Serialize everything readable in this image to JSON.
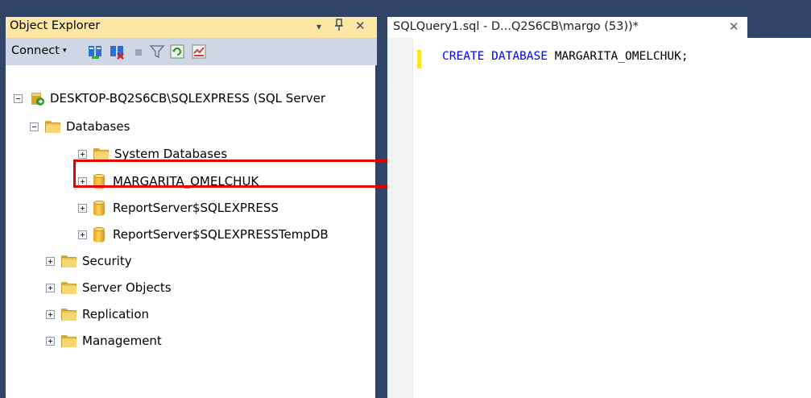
{
  "object_explorer": {
    "title": "Object Explorer",
    "controls": {
      "dropdown": "▾",
      "pin": "ꟷ",
      "close": "✕"
    },
    "connect_label": "Connect",
    "connect_arrow": "▾",
    "toolbar_icons": [
      "connect-object-explorer-icon",
      "disconnect-icon",
      "stop-icon",
      "filter-icon",
      "refresh-icon",
      "activity-monitor-icon"
    ],
    "tree": [
      {
        "label": "DESKTOP-BQ2S6CB\\SQLEXPRESS (SQL Server",
        "icon": "server-icon",
        "expanded": true
      },
      {
        "label": "Databases",
        "icon": "folder-icon",
        "expanded": true
      },
      {
        "label": "System Databases",
        "icon": "folder-icon",
        "expanded": false
      },
      {
        "label": "MARGARITA_OMELCHUK",
        "icon": "database-icon",
        "expanded": false
      },
      {
        "label": "ReportServer$SQLEXPRESS",
        "icon": "database-icon",
        "expanded": false
      },
      {
        "label": "ReportServer$SQLEXPRESSTempDB",
        "icon": "database-icon",
        "expanded": false
      },
      {
        "label": "Security",
        "icon": "folder-icon",
        "expanded": false
      },
      {
        "label": "Server Objects",
        "icon": "folder-icon",
        "expanded": false
      },
      {
        "label": "Replication",
        "icon": "folder-icon",
        "expanded": false
      },
      {
        "label": "Management",
        "icon": "folder-icon",
        "expanded": false
      }
    ]
  },
  "editor": {
    "tab_title": "SQLQuery1.sql - D...Q2S6CB\\margo (53))*",
    "tab_close": "✕",
    "code": {
      "keyword1": "CREATE",
      "keyword2": "DATABASE",
      "identifier": "MARGARITA_OMELCHUK",
      "terminator": ";"
    }
  },
  "colors": {
    "background": "#2d4163",
    "panel_title": "#ffe8a6",
    "toolbar": "#cfd6e5",
    "highlight": "#e30000",
    "keyword": "#0000ff"
  }
}
